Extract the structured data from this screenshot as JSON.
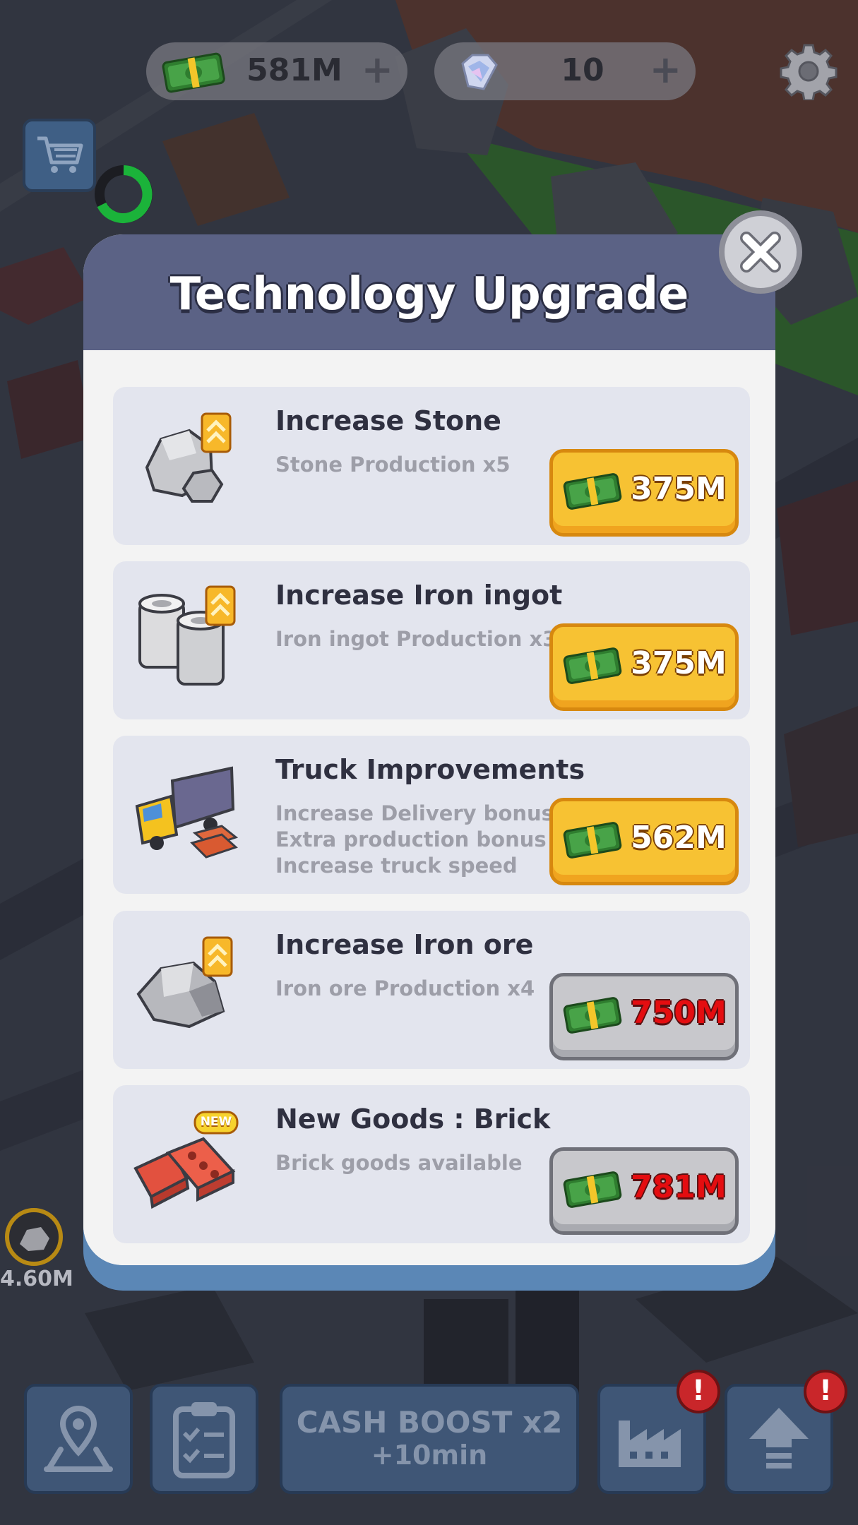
{
  "hud": {
    "cash": {
      "value": "581M",
      "plus": "+",
      "icon": "cash-icon"
    },
    "gems": {
      "value": "10",
      "plus": "+",
      "icon": "gem-icon"
    },
    "settings_icon": "gear-icon",
    "shop_icon": "cart-icon"
  },
  "dialog": {
    "title": "Technology Upgrade",
    "close_icon": "close-icon"
  },
  "upgrades": [
    {
      "name": "Increase Stone",
      "desc": [
        "Stone Production x5"
      ],
      "price": "375M",
      "state": "active",
      "icon": "stone-icon",
      "badge": "rank-up-icon"
    },
    {
      "name": "Increase Iron ingot",
      "desc": [
        "Iron ingot Production x3"
      ],
      "price": "375M",
      "state": "active",
      "icon": "iron-ingot-icon",
      "badge": "rank-up-icon"
    },
    {
      "name": "Truck Improvements",
      "desc": [
        "Increase Delivery bonus",
        "Extra production bonus",
        "Increase truck speed"
      ],
      "price": "562M",
      "state": "active",
      "icon": "truck-icon",
      "badge": ""
    },
    {
      "name": "Increase Iron ore",
      "desc": [
        "Iron ore Production x4"
      ],
      "price": "750M",
      "state": "locked",
      "icon": "iron-ore-icon",
      "badge": "rank-up-icon"
    },
    {
      "name": "New Goods : Brick",
      "desc": [
        "Brick goods available"
      ],
      "price": "781M",
      "state": "locked",
      "icon": "brick-icon",
      "badge": "NEW"
    }
  ],
  "side": {
    "production_label": "4.60M"
  },
  "bottom_bar": {
    "map_icon": "map-icon",
    "tasks_icon": "clipboard-icon",
    "boost": {
      "line1": "CASH BOOST x2",
      "line2": "+10min"
    },
    "factory_icon": "factory-icon",
    "upgrade_icon": "upgrade-arrow-icon",
    "alert_mark": "!"
  },
  "colors": {
    "header": "#5b6285",
    "button_active": "#f7c233",
    "button_locked": "#c8c8cc",
    "price_locked": "#e40d10"
  }
}
